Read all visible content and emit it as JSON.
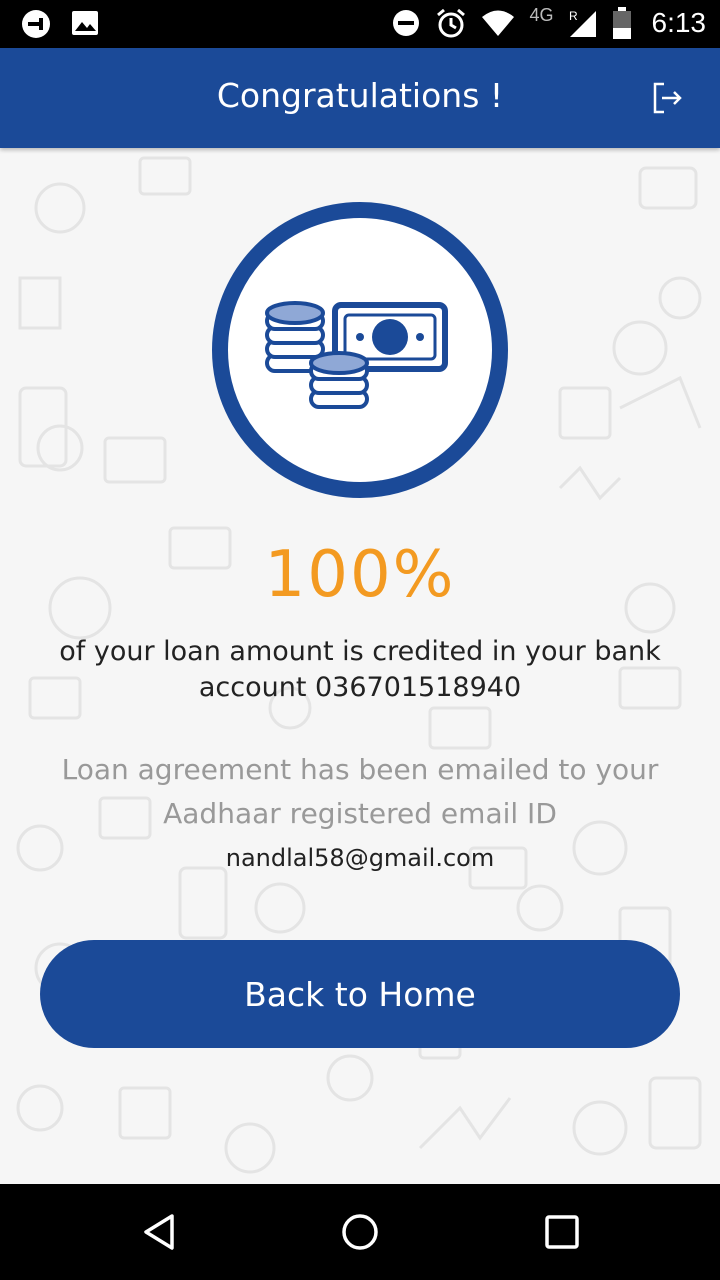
{
  "status_bar": {
    "time": "6:13",
    "network": "4G",
    "icons": [
      "notification-icon",
      "image-icon",
      "do-not-disturb-icon",
      "alarm-icon",
      "wifi-icon",
      "cell-signal-icon",
      "battery-icon"
    ]
  },
  "header": {
    "title": "Congratulations !",
    "logout_icon": "logout-icon"
  },
  "main": {
    "hero_icon": "money-coins-icon",
    "percent": "100%",
    "credit_message": "of your loan amount is credited in your bank account 036701518940",
    "agreement_message": "Loan agreement has been emailed to your Aadhaar registered email ID",
    "email": "nandlal58@gmail.com",
    "home_button_label": "Back to Home"
  },
  "nav_bar": {
    "icons": [
      "back-icon",
      "home-icon",
      "recents-icon"
    ]
  },
  "colors": {
    "primary": "#1b4a98",
    "accent": "#f39a21",
    "muted_text": "#999999"
  }
}
